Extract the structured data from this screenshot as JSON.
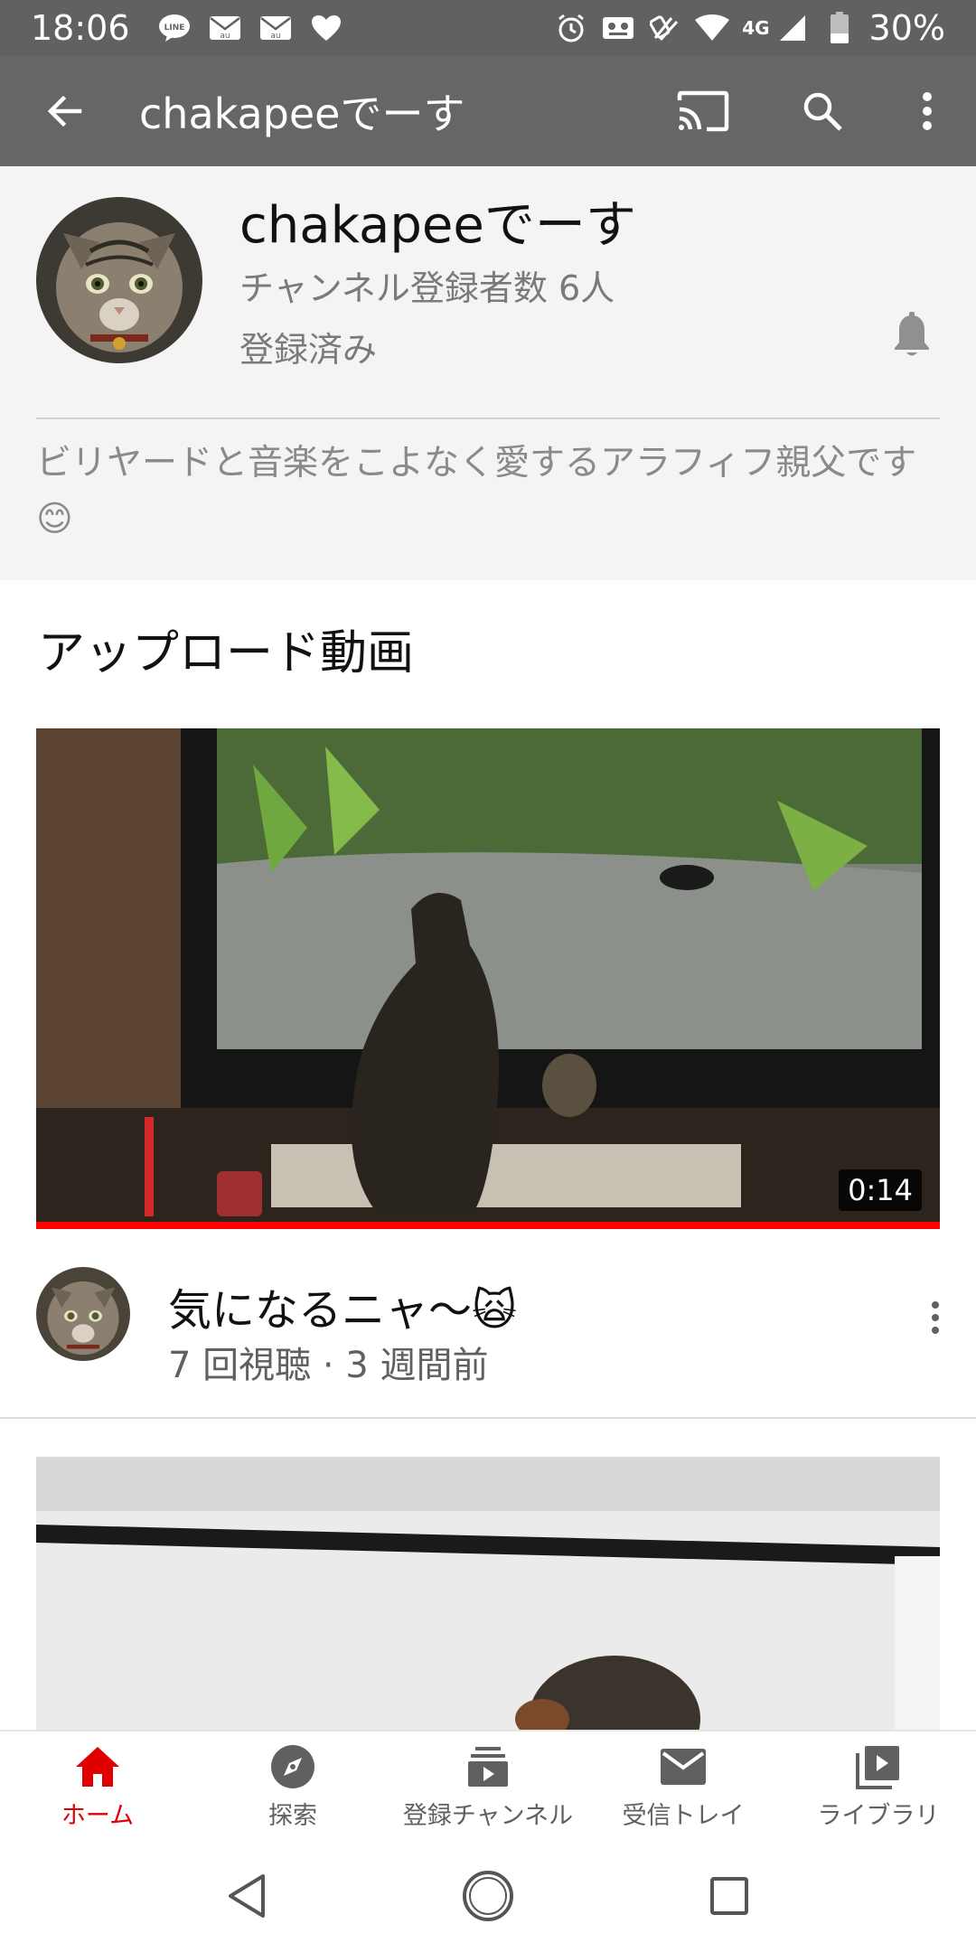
{
  "status_bar": {
    "time": "18:06",
    "battery_percent": "30%",
    "network": "4G",
    "left_icons": [
      "line-icon",
      "au-mail-icon",
      "au-mail-icon",
      "heart-icon"
    ],
    "right_icons": [
      "alarm-icon",
      "voicemail-icon",
      "nfc-icon",
      "wifi-icon",
      "signal-icon",
      "battery-icon"
    ]
  },
  "app_bar": {
    "title": "chakapeeでーす",
    "actions": [
      "cast-icon",
      "search-icon",
      "more-vert-icon"
    ]
  },
  "channel": {
    "name": "chakapeeでーす",
    "subscriber_count": "チャンネル登録者数 6人",
    "subscription_status": "登録済み",
    "description": "ビリヤードと音楽をこよなく愛するアラフィフ親父です😊"
  },
  "section": {
    "title": "アップロード動画"
  },
  "videos": [
    {
      "duration": "0:14",
      "title": "気になるニャ〜🙀",
      "meta": "7 回視聴 · 3 週間前",
      "watched_fraction": 1.0
    }
  ],
  "bottom_nav": {
    "items": [
      {
        "label": "ホーム",
        "icon": "home-icon",
        "active": true
      },
      {
        "label": "探索",
        "icon": "explore-icon",
        "active": false
      },
      {
        "label": "登録チャンネル",
        "icon": "subscriptions-icon",
        "active": false
      },
      {
        "label": "受信トレイ",
        "icon": "inbox-icon",
        "active": false
      },
      {
        "label": "ライブラリ",
        "icon": "library-icon",
        "active": false
      }
    ]
  },
  "colors": {
    "brand_red": "#e00000",
    "app_bar": "#666666",
    "status_bar": "#616161"
  }
}
